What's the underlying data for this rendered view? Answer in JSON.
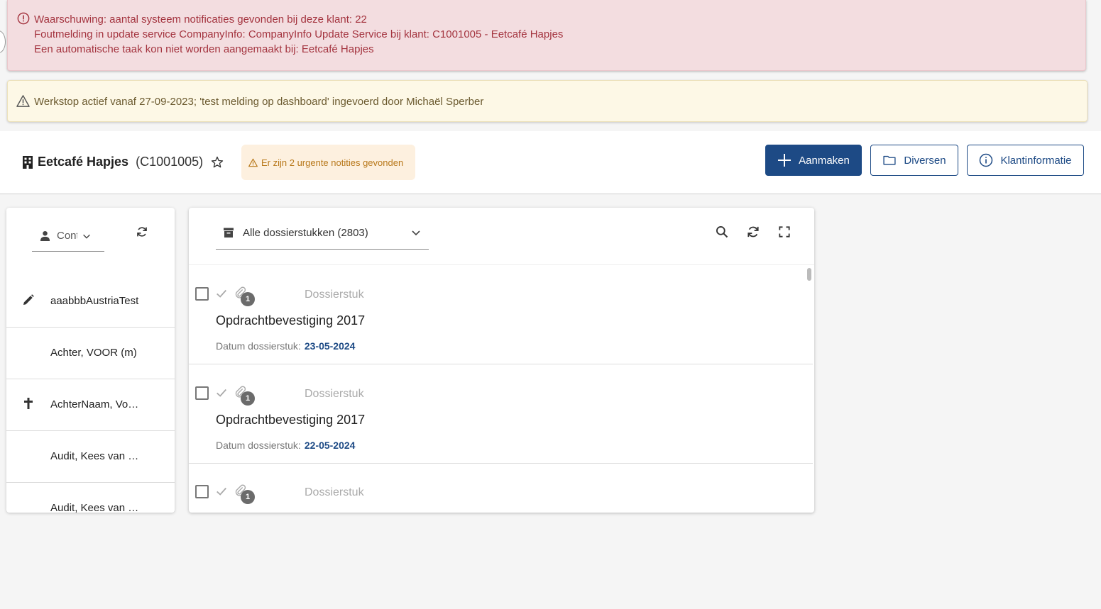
{
  "alerts": {
    "error_lines": [
      "Waarschuwing: aantal systeem notificaties gevonden bij deze klant: 22",
      "Foutmelding in update service CompanyInfo: CompanyInfo Update Service bij klant: C1001005 - Eetcafé Hapjes",
      "Een automatische taak kon niet worden aangemaakt bij: Eetcafé Hapjes"
    ],
    "warning": "Werkstop actief vanaf 27-09-2023; 'test melding op dashboard' ingevoerd door Michaël Sperber"
  },
  "header": {
    "company_name": "Eetcafé Hapjes",
    "company_code": "(C1001005)",
    "urgent_notice": "Er zijn 2 urgente notities gevonden",
    "create_label": "Aanmaken",
    "misc_label": "Diversen",
    "info_label": "Klantinformatie"
  },
  "contacts": {
    "select_label": "Contacten",
    "items": [
      {
        "name": "aaabbbAustriaTest",
        "icon": "pencil-icon"
      },
      {
        "name": "Achter, VOOR (m)",
        "icon": ""
      },
      {
        "name": "AchterNaam, Voornaam",
        "icon": "cross-icon"
      },
      {
        "name": "Audit, Kees van der",
        "icon": ""
      },
      {
        "name": "Audit, Kees van der",
        "icon": ""
      }
    ]
  },
  "documents": {
    "select_label": "Alle dossierstukken (2803)",
    "date_label": "Datum dossierstuk:",
    "rows": [
      {
        "type": "Dossierstuk",
        "title": "Opdrachtbevestiging 2017",
        "date": "23-05-2024",
        "attachments": "1"
      },
      {
        "type": "Dossierstuk",
        "title": "Opdrachtbevestiging 2017",
        "date": "22-05-2024",
        "attachments": "1"
      },
      {
        "type": "Dossierstuk",
        "title": "",
        "date": "",
        "attachments": "1"
      }
    ]
  },
  "colors": {
    "primary": "#1d4a85",
    "error_bg": "#f3dde0",
    "warning_bg": "#fdf8e6",
    "urgent_bg": "#fdf0df"
  }
}
